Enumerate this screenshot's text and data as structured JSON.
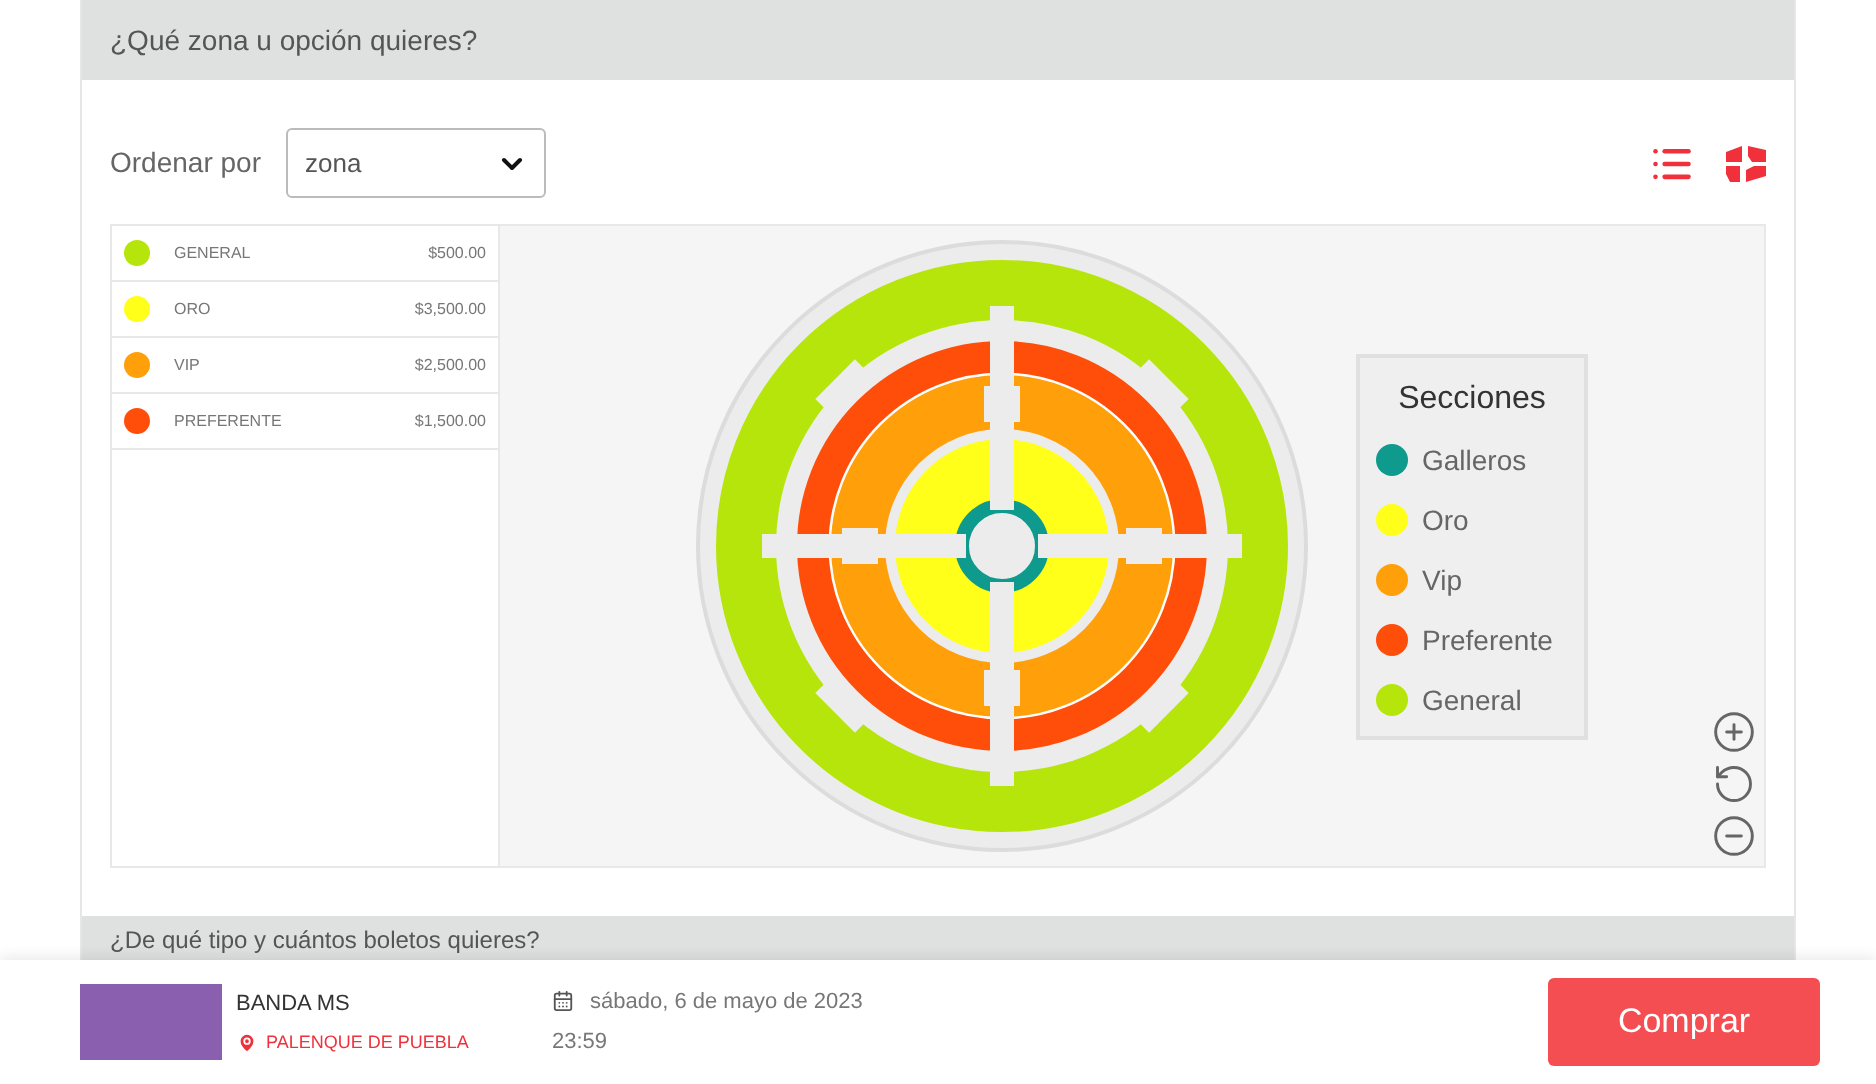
{
  "zone_section": {
    "title": "¿Qué zona u opción quieres?"
  },
  "sort": {
    "label": "Ordenar por",
    "value": "zona"
  },
  "zones": [
    {
      "name": "GENERAL",
      "price": "$500.00",
      "color": "#b5e50a"
    },
    {
      "name": "ORO",
      "price": "$3,500.00",
      "color": "#ffff1a"
    },
    {
      "name": "VIP",
      "price": "$2,500.00",
      "color": "#ff9f0a"
    },
    {
      "name": "PREFERENTE",
      "price": "$1,500.00",
      "color": "#ff4e0a"
    }
  ],
  "legend": {
    "title": "Secciones",
    "items": [
      {
        "name": "Galleros",
        "color": "#0e9a8c"
      },
      {
        "name": "Oro",
        "color": "#ffff1a"
      },
      {
        "name": "Vip",
        "color": "#ff9f0a"
      },
      {
        "name": "Preferente",
        "color": "#ff4e0a"
      },
      {
        "name": "General",
        "color": "#b5e50a"
      }
    ]
  },
  "ticket_section": {
    "title": "¿De qué tipo y cuántos boletos quieres?"
  },
  "event": {
    "name": "BANDA MS",
    "venue": "PALENQUE DE PUEBLA",
    "date": "sábado, 6 de mayo de 2023",
    "time": "23:59"
  },
  "buy_button": "Comprar"
}
